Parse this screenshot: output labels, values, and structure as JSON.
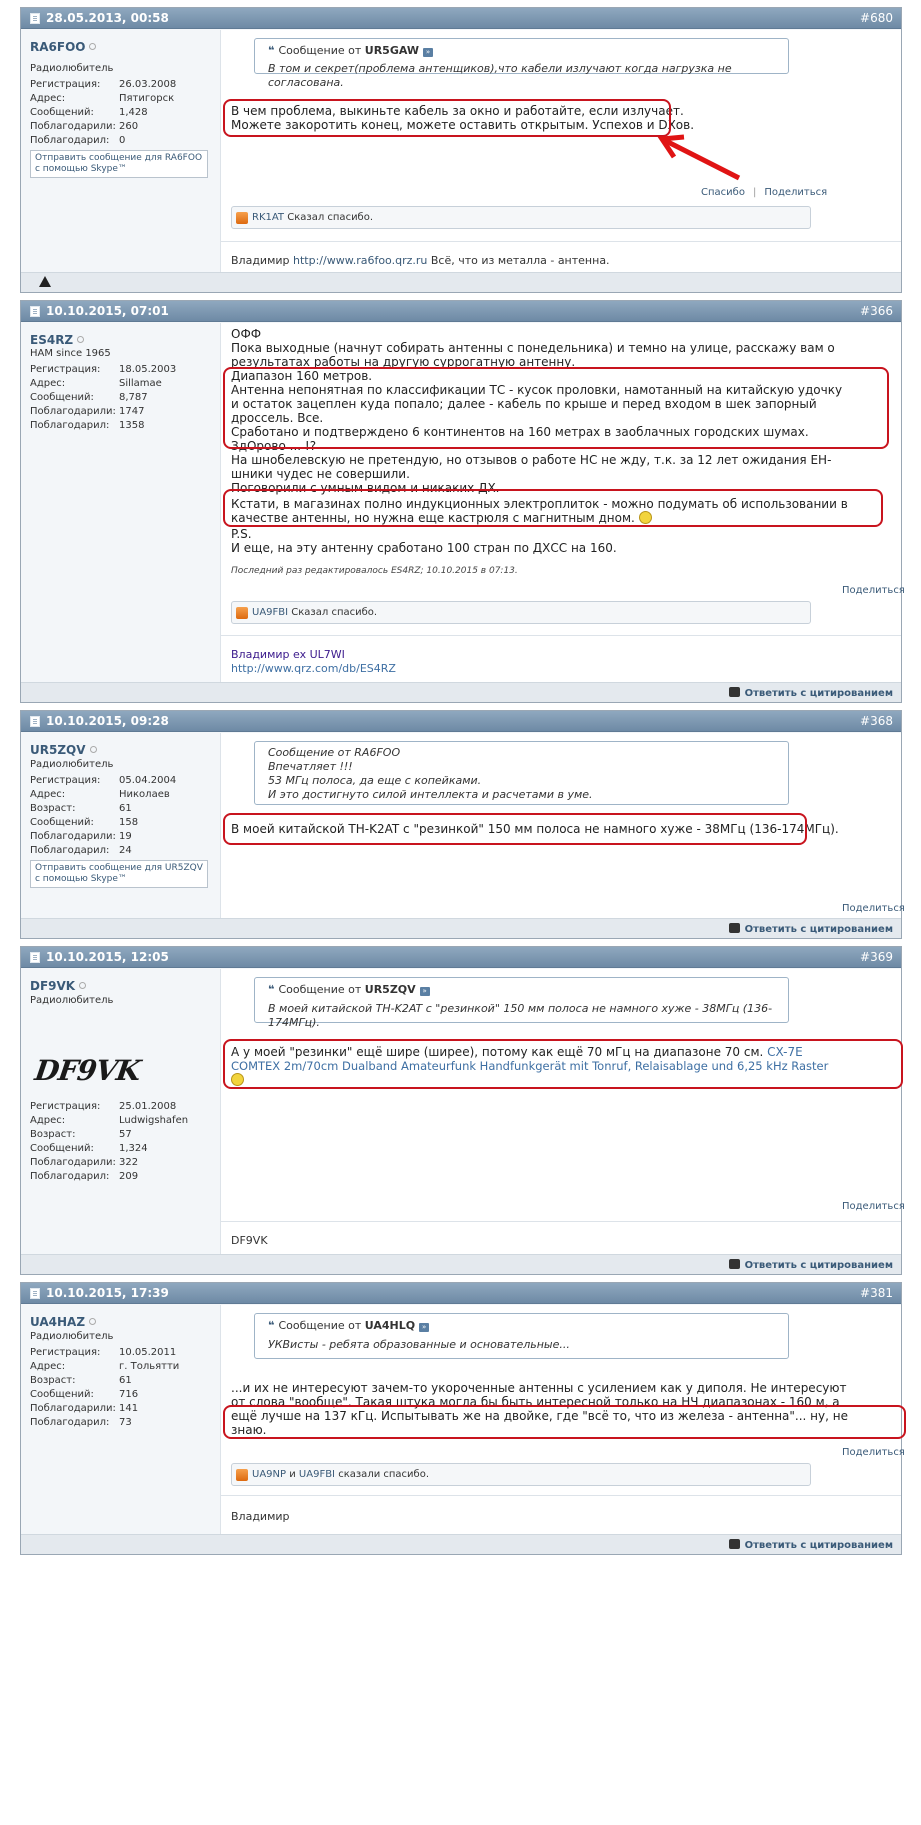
{
  "posts": [
    {
      "date": "28.05.2013, 00:58",
      "num": "#680",
      "user": "RA6FOO",
      "title": "Радиолюбитель",
      "stats": [
        [
          "Регистрация:",
          "26.03.2008"
        ],
        [
          "Адрес:",
          "Пятигорск"
        ],
        [
          "Сообщений:",
          "1,428"
        ],
        [
          "Поблагодарили:",
          "260"
        ],
        [
          "Поблагодарил:",
          "0"
        ]
      ],
      "skype": "Отправить сообщение для RA6FOO с помощью Skype™",
      "quote_author": "UR5GAW",
      "quote_text": "В том и секрет(проблема антенщиков),что кабели излучают когда нагрузка не согласована.",
      "lines": [
        "В чем проблема, выкиньте кабель за окно и работайте, если излучает.",
        "Можете закоротить конец, можете оставить открытым. Успехов и DXов."
      ],
      "thanks_user": "RK1AT",
      "thanks_text": "Сказал спасибо.",
      "sig_name": "Владимир",
      "sig_url": "http://www.ra6foo.qrz.ru",
      "sig_tail": "Всё, что из металла - антенна."
    },
    {
      "date": "10.10.2015, 07:01",
      "num": "#366",
      "user": "ES4RZ",
      "title": "HAM since 1965",
      "stats": [
        [
          "Регистрация:",
          "18.05.2003"
        ],
        [
          "Адрес:",
          "Sillamae"
        ],
        [
          "Сообщений:",
          "8,787"
        ],
        [
          "Поблагодарили:",
          "1747"
        ],
        [
          "Поблагодарил:",
          "1358"
        ]
      ],
      "lines": [
        "ОФФ",
        "Пока выходные (начнут собирать антенны с понедельника) и темно на улице, расскажу вам о",
        "результатах работы на другую суррогатную антенну.",
        "Диапазон 160 метров.",
        "Антенна непонятная по классификации ТС - кусок проловки, намотанный на китайскую удочку",
        "и остаток зацеплен куда попало; далее - кабель по крыше и перед входом в шек запорный",
        "дроссель. Все.",
        "Сработано и подтверждено 6 континентов на 160 метрах в заоблачных городских шумах.",
        "ЗдОрово ... !?",
        "На шнобелевскую не претендую, но отзывов о работе НС не жду, т.к. за 12 лет ожидания ЕН-",
        "шники чудес не совершили.",
        "Поговорили с умным видом и никаких ДХ.",
        "Кстати, в магазинах полно индукционных электроплиток - можно подумать об использовании в",
        "качестве антенны, но нужна еще кастрюля с магнитным дном.",
        "P.S.",
        "И еще, на эту антенну сработано 100 стран по ДХСС на 160."
      ],
      "edited": "Последний раз редактировалось ES4RZ; 10.10.2015 в 07:13.",
      "thanks_user": "UA9FBI",
      "thanks_text": "Сказал спасибо.",
      "sig_name": "Владимир ex UL7WI",
      "sig_url": "http://www.qrz.com/db/ES4RZ"
    },
    {
      "date": "10.10.2015, 09:28",
      "num": "#368",
      "user": "UR5ZQV",
      "title": "Радиолюбитель",
      "stats": [
        [
          "Регистрация:",
          "05.04.2004"
        ],
        [
          "Адрес:",
          "Николаев"
        ],
        [
          "Возраст:",
          "61"
        ],
        [
          "Сообщений:",
          "158"
        ],
        [
          "Поблагодарили:",
          "19"
        ],
        [
          "Поблагодарил:",
          "24"
        ]
      ],
      "skype": "Отправить сообщение для UR5ZQV с помощью Skype™",
      "quote_lines": [
        "Сообщение от RA6FOO",
        "Впечатляет !!!",
        "53 МГц полоса, да еще с копейками.",
        "И это достигнуто силой интеллекта и расчетами в уме."
      ],
      "lines": [
        "В моей китайской TH-K2AT с \"резинкой\" 150 мм полоса не намного хуже - 38МГц (136-174МГц)."
      ]
    },
    {
      "date": "10.10.2015, 12:05",
      "num": "#369",
      "user": "DF9VK",
      "title": "Радиолюбитель",
      "avatar": "DF9VK",
      "stats": [
        [
          "Регистрация:",
          "25.01.2008"
        ],
        [
          "Адрес:",
          "Ludwigshafen"
        ],
        [
          "Возраст:",
          "57"
        ],
        [
          "Сообщений:",
          "1,324"
        ],
        [
          "Поблагодарили:",
          "322"
        ],
        [
          "Поблагодарил:",
          "209"
        ]
      ],
      "quote_author": "UR5ZQV",
      "quote_text": "В моей китайской TH-K2AT с \"резинкой\" 150 мм полоса не намного хуже - 38МГц (136-174МГц).",
      "lines": [
        "А у моей \"резинки\" ещё шире (ширее), потому как ещё 70 мГц на диапазоне 70 см."
      ],
      "link1": "CX-7E",
      "link2": "COMTEX 2m/70cm Dualband Amateurfunk Handfunkgerät mit Tonruf, Relaisablage und 6,25 kHz Raster",
      "sig_name": "DF9VK"
    },
    {
      "date": "10.10.2015, 17:39",
      "num": "#381",
      "user": "UA4HAZ",
      "title": "Радиолюбитель",
      "stats": [
        [
          "Регистрация:",
          "10.05.2011"
        ],
        [
          "Адрес:",
          "г. Тольятти"
        ],
        [
          "Возраст:",
          "61"
        ],
        [
          "Сообщений:",
          "716"
        ],
        [
          "Поблагодарили:",
          "141"
        ],
        [
          "Поблагодарил:",
          "73"
        ]
      ],
      "quote_author": "UA4HLQ",
      "quote_text": "УКВисты - ребята образованные и основательные...",
      "lines": [
        "...и их не интересуют зачем-то укороченные антенны с усилением как у диполя. Не интересуют",
        "от слова \"вообще\". Такая штука могла бы быть интересной только на НЧ диапазонах - 160 м, а",
        "ещё лучше на 137 кГц. Испытывать же на двойке, где \"всё то, что из железа - антенна\"... ну, не",
        "знаю."
      ],
      "thanks_users": [
        "UA9NP",
        "UA9FBI"
      ],
      "thanks_and": "и",
      "thanks_text": "сказали спасибо.",
      "sig_name": "Владимир"
    }
  ],
  "ui": {
    "quote_prefix": "Сообщение от",
    "thanks_label": "Спасибо",
    "share_label": "Поделиться",
    "reply_label": "Ответить с цитированием",
    "sep": "|"
  }
}
